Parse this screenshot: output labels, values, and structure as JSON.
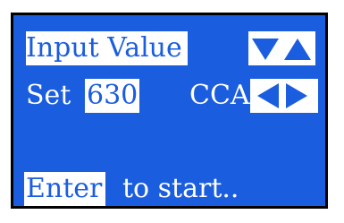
{
  "screen": {
    "title": "Input Value",
    "set_label": "Set",
    "set_value": "630",
    "unit_label": "CCA",
    "enter_label": "Enter",
    "start_text": "to start.."
  },
  "colors": {
    "background": "#1a5ddf",
    "text": "#ffffff"
  },
  "icons": {
    "up_down": [
      "triangle-down-icon",
      "triangle-up-icon"
    ],
    "left_right": [
      "triangle-left-icon",
      "triangle-right-icon"
    ]
  }
}
